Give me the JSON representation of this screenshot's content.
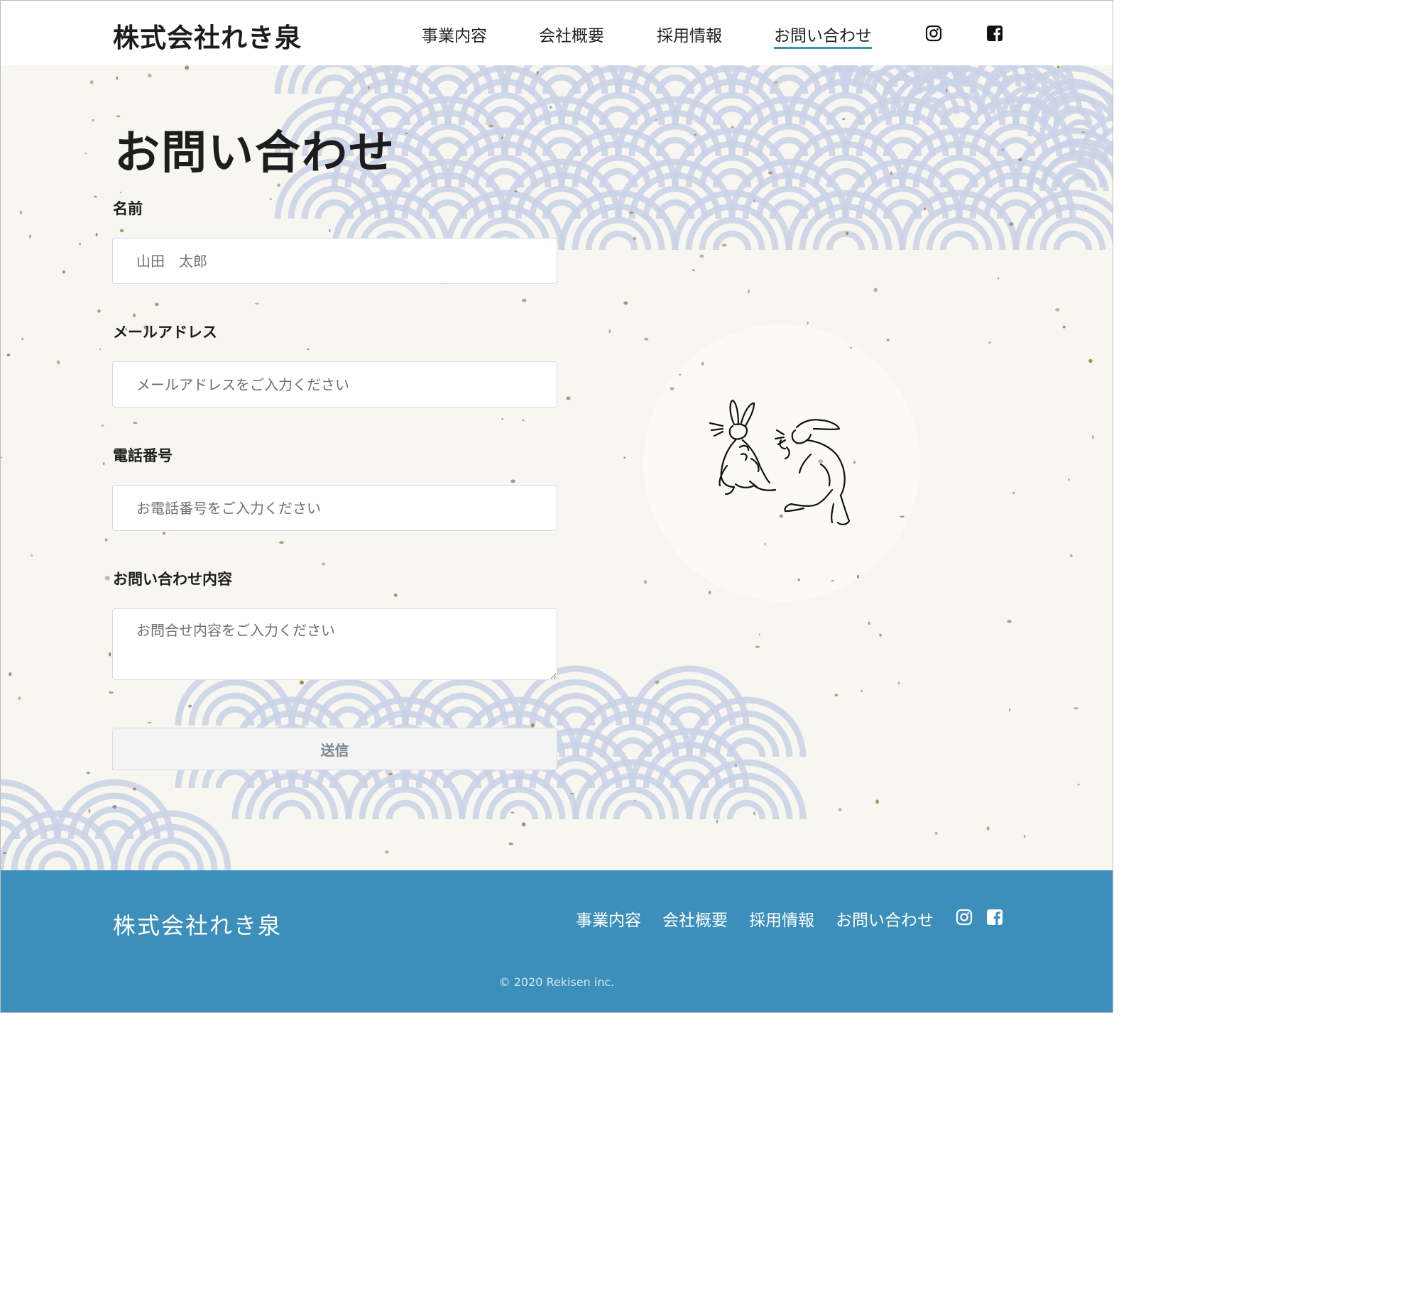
{
  "header": {
    "brand": "株式会社れき泉",
    "nav": [
      "事業内容",
      "会社概要",
      "採用情報",
      "お問い合わせ"
    ],
    "active_nav": "お問い合わせ",
    "social_icons": [
      "instagram-icon",
      "facebook-icon"
    ]
  },
  "main": {
    "title": "お問い合わせ",
    "form": {
      "name_label": "名前",
      "name_placeholder": "山田　太郎",
      "email_label": "メールアドレス",
      "email_placeholder": "メールアドレスをご入力ください",
      "phone_label": "電話番号",
      "phone_placeholder": "お電話番号をご入力ください",
      "message_label": "お問い合わせ内容",
      "message_placeholder": "お問合せ内容をご入力ください",
      "submit_label": "送信"
    },
    "illustration": "rabbits-illustration"
  },
  "footer": {
    "brand": "株式会社れき泉",
    "nav": [
      "事業内容",
      "会社概要",
      "採用情報",
      "お問い合わせ"
    ],
    "copyright": "© 2020 Rekisen inc."
  },
  "colors": {
    "accent": "#3c8fba",
    "wave_pattern": "#c9d2e6",
    "background": "#f8f6f1"
  }
}
